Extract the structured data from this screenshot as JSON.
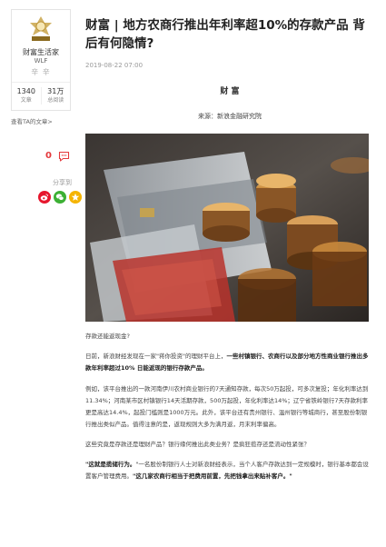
{
  "author": {
    "logo_text": "财富生活",
    "name": "财富生活家",
    "sub": "WLF",
    "separator": "辛 辛",
    "stats": [
      {
        "num": "1340",
        "label": "文章"
      },
      {
        "num": "31万",
        "label": "总阅读"
      }
    ],
    "view_articles": "查看TA的文章>"
  },
  "interaction": {
    "comment_count": "0",
    "share_label": "分享到",
    "share_targets": [
      {
        "icon": "weibo-icon",
        "color": "#e6162d"
      },
      {
        "icon": "wechat-icon",
        "color": "#3cb034"
      },
      {
        "icon": "qzone-icon",
        "color": "#f5b400"
      }
    ]
  },
  "article": {
    "title": "财富 | 地方农商行推出年利率超10%的存款产品 背后有何隐情?",
    "date": "2019-08-22 07:00",
    "section": "财 富",
    "source": "来源：新浪金融研究院",
    "paragraphs": {
      "p1": "存款还能返现金?",
      "p2_a": "日前，新浪财经发现在一家\"蒋你投资\"的理财平台上，",
      "p2_b": "一些村镇银行、农商行以及部分地方性商业银行推出多款年利率超过10% 日能返现的银行存款产品。",
      "p3": "例如，该平台推出的一款河南伊川农村商业银行的7天通知存款，每次50万起投，可多次复投；年化利率达到11.34%；河南某市区村镇银行14天活期存款，500万起投，年化利率达14%；辽宁省铁岭银行7天存款利率更是高达14.4%，起投门槛则是1000万元。此外，该平台还有贵州银行、温州银行等城商行，甚至股份制银行推出类似产品。值得注意的是，返现规则大多为满月返，月末利率偏高。",
      "p4": "这些究竟是存款还是理财产品？银行缘何推出此类业务？是疯狂揽存还是流动性紧张？",
      "p5_a": "\"这就是揽储行为。",
      "p5_b": "\"一名股份制银行人士对新浪财经表示，当个人客户存款达到一定规模时，银行基本都会设置客户管理费用。",
      "p5_c": "\"这几家农商行相当于把费用前置，先把钱拿出来贴补客户。\""
    }
  }
}
